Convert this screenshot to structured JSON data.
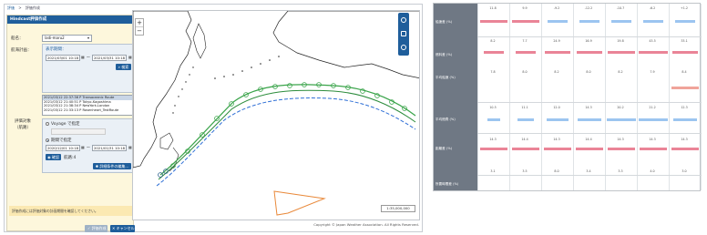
{
  "breadcrumb": [
    "評価",
    ">",
    "評価作成"
  ],
  "panel": {
    "title": "Hindcast評価作成",
    "ship_label": "船名：",
    "ship_value": "ladi-maru2",
    "plan_label": "航海計画：",
    "period_title": "表示期間：",
    "period_from": "2021/03/01 10:18",
    "period_to": "2021/03/31 10:18",
    "period_separator": "〜",
    "search_button": "検索",
    "routes": [
      "2021/03/12 22:37:36 P Transoceanic Route",
      "2021/03/12 21:40:51 P Tokyo-Kagoshima",
      "2021/03/12 21:38:34 P NewYork-London",
      "2021/03/12 21:33:13 P Rosenheart_TestRoute"
    ],
    "target_label": "評価対象",
    "target_sublabel": "（航路）",
    "option_voyage": "Voyage で指定",
    "option_period": "期間で指定",
    "target_from": "2020/12/01 10:18",
    "target_to": "2021/01/31 10:18",
    "confirm_button": "確認",
    "period_count": "航路:4",
    "detail_button": "詳細条件の編集...",
    "notice": "評価作成には評価対象の計画期間を確認してください。",
    "create_button": "評価作成",
    "cancel_button": "キャンセル"
  },
  "map": {
    "zoom_in": "+",
    "zoom_out": "−",
    "scale": "1:35,000,000",
    "scale_unit": "scale",
    "copyright": "Copyright © Japan Weather Association. All Rights Reserved."
  },
  "table": {
    "row_labels": [
      "船速差 (%)",
      "燃料差 (%)",
      "平均船速 (%)",
      "平均燃費 (%)",
      "距離差 (%)",
      "所要時間差 (%)"
    ],
    "values_top": [
      "11.8",
      "9.9",
      "-9.2",
      "-12.2",
      "-10.7",
      "-6.2",
      "+1.2"
    ],
    "values_fuel": [
      "8.2",
      "7.7",
      "24.9",
      "16.9",
      "19.8",
      "43.5",
      "33.1"
    ],
    "values_speed": [
      "7.8",
      "8.0",
      "8.2",
      "8.0",
      "8.2",
      "7.9",
      "8.4"
    ],
    "values_cons": [
      "10.5",
      "11.1",
      "12.0",
      "14.3",
      "20.2",
      "21.2",
      "12.3"
    ],
    "values_dist": [
      "14.3",
      "14.4",
      "14.3",
      "14.4",
      "14.3",
      "14.3",
      "14.3"
    ],
    "values_time": [
      "3.1",
      "3.5",
      "8.0",
      "3.4",
      "3.3",
      "4.0",
      "3.0"
    ],
    "colors": {
      "pink": "#ea8497",
      "blue": "#9cc5f0",
      "salmon": "#f0a49a"
    }
  }
}
